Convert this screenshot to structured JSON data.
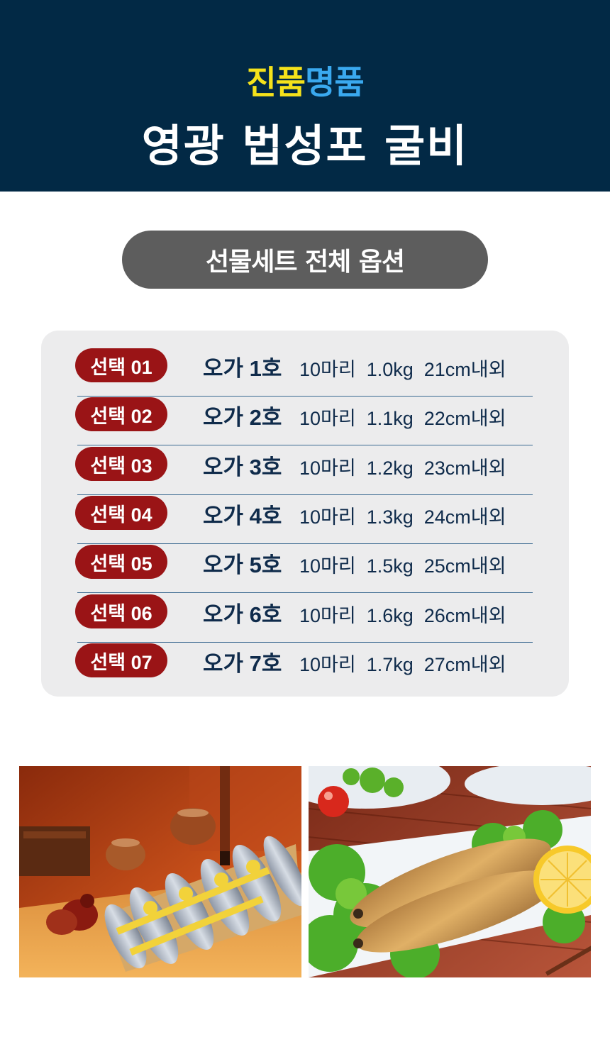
{
  "header": {
    "brand_part1": "진품",
    "brand_part2": "명품",
    "title": "영광 법성포 굴비"
  },
  "section_title": "선물세트 전체 옵션",
  "options": [
    {
      "badge": "선택 01",
      "name": "오가 1호",
      "spec": "10마리  1.0kg  21cm내외"
    },
    {
      "badge": "선택 02",
      "name": "오가 2호",
      "spec": "10마리  1.1kg  22cm내외"
    },
    {
      "badge": "선택 03",
      "name": "오가 3호",
      "spec": "10마리  1.2kg  23cm내외"
    },
    {
      "badge": "선택 04",
      "name": "오가 4호",
      "spec": "10마리  1.3kg  24cm내외"
    },
    {
      "badge": "선택 05",
      "name": "오가 5호",
      "spec": "10마리  1.5kg  25cm내외"
    },
    {
      "badge": "선택 06",
      "name": "오가 6호",
      "spec": "10마리  1.6kg  26cm내외"
    },
    {
      "badge": "선택 07",
      "name": "오가 7호",
      "spec": "10마리  1.7kg  27cm내외"
    }
  ],
  "colors": {
    "header_bg": "#022945",
    "brand_yellow": "#f5e21b",
    "brand_blue": "#3aa9ef",
    "pill_bg": "#5d5d5d",
    "panel_bg": "#ececed",
    "badge_red": "#9a1416",
    "text_navy": "#0f2b4b"
  }
}
